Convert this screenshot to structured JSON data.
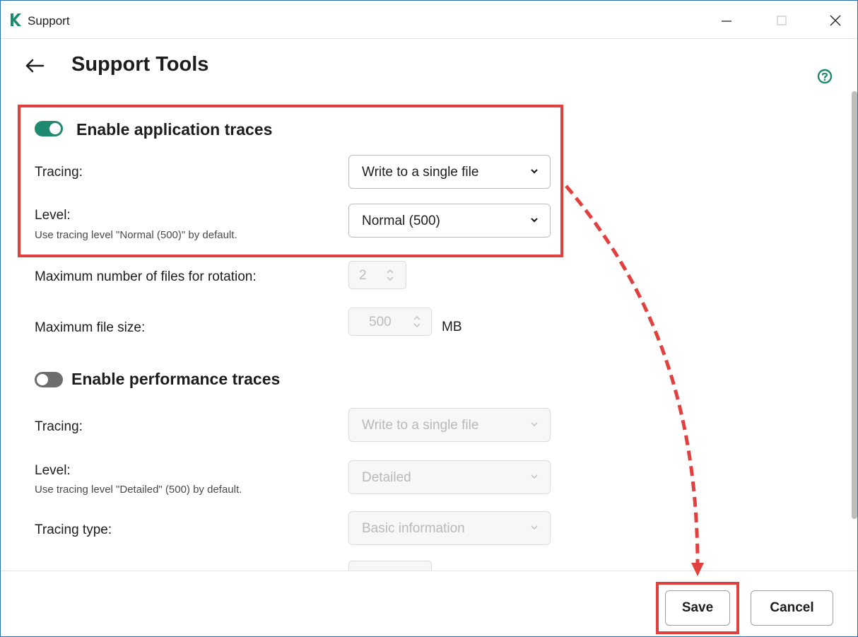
{
  "window": {
    "title": "Support",
    "minimize_glyph": "—",
    "maximize_glyph": "☐",
    "close_glyph": "✕"
  },
  "page": {
    "title": "Support Tools"
  },
  "app_traces": {
    "title": "Enable application traces",
    "enabled": true,
    "tracing_label": "Tracing:",
    "tracing_value": "Write to a single file",
    "level_label": "Level:",
    "level_hint": "Use tracing level \"Normal (500)\" by default.",
    "level_value": "Normal (500)",
    "rotation_label": "Maximum number of files for rotation:",
    "rotation_value": "2",
    "filesize_label": "Maximum file size:",
    "filesize_value": "500",
    "filesize_unit": "MB"
  },
  "perf_traces": {
    "title": "Enable performance traces",
    "enabled": false,
    "tracing_label": "Tracing:",
    "tracing_value": "Write to a single file",
    "level_label": "Level:",
    "level_hint": "Use tracing level \"Detailed\" (500) by default.",
    "level_value": "Detailed",
    "type_label": "Tracing type:",
    "type_value": "Basic information"
  },
  "footer": {
    "save_label": "Save",
    "cancel_label": "Cancel"
  },
  "colors": {
    "accent": "#1f8a70",
    "highlight": "#e0403e",
    "window_border": "#2f6fb5"
  }
}
